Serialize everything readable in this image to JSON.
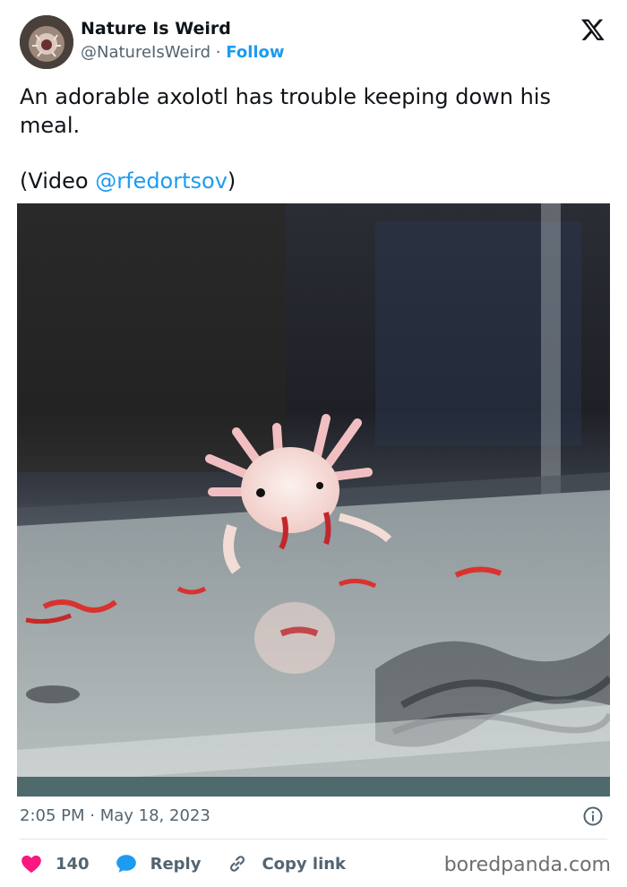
{
  "author": {
    "name": "Nature Is Weird",
    "handle": "@NatureIsWeird",
    "separator": "·",
    "follow_label": "Follow"
  },
  "tweet": {
    "line1": "An adorable axolotl has trouble keeping down his",
    "line2": "meal.",
    "video_prefix": "(Video ",
    "video_mention": "@rfedortsov",
    "video_suffix": ")"
  },
  "meta": {
    "time": "2:05 PM",
    "separator": " · ",
    "date": "May 18, 2023"
  },
  "actions": {
    "likes": "140",
    "reply_label": "Reply",
    "copy_label": "Copy link"
  },
  "watermark": "boredpanda.com",
  "icons": {
    "platform": "x-logo-icon",
    "info": "info-icon",
    "like": "heart-icon",
    "reply": "reply-bubble-icon",
    "copy": "link-icon"
  },
  "colors": {
    "accent": "#1d9bf0",
    "like": "#f91880",
    "text": "#0f1419",
    "muted": "#536471"
  }
}
